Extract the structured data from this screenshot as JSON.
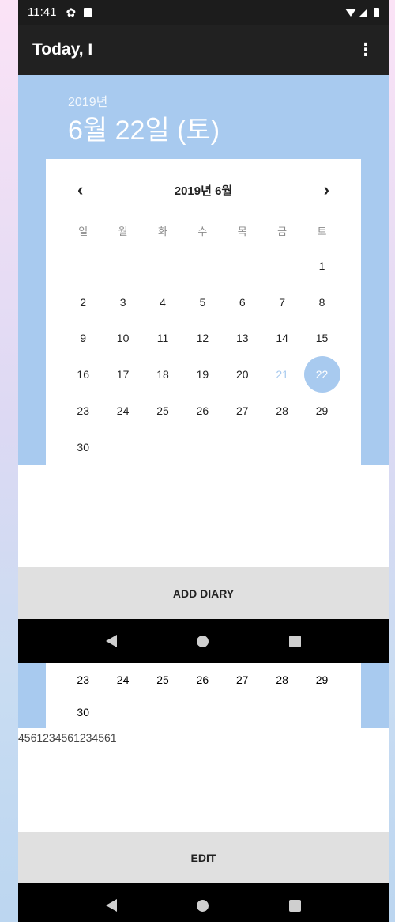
{
  "status_bar": {
    "time": "11:41",
    "icons": [
      "gear-icon",
      "sd-card-icon",
      "wifi-icon",
      "signal-icon",
      "battery-icon"
    ]
  },
  "appbar": {
    "title": "Today, I",
    "menu_icon": "more-vert-icon"
  },
  "header": {
    "year": "2019년",
    "date": "6월 22일 (토)"
  },
  "calendar": {
    "month_label": "2019년 6월",
    "weekdays": [
      "일",
      "월",
      "화",
      "수",
      "목",
      "금",
      "토"
    ],
    "days": [
      "1",
      "2",
      "3",
      "4",
      "5",
      "6",
      "7",
      "8",
      "9",
      "10",
      "11",
      "12",
      "13",
      "14",
      "15",
      "16",
      "17",
      "18",
      "19",
      "20",
      "21",
      "22",
      "23",
      "24",
      "25",
      "26",
      "27",
      "28",
      "29",
      "30"
    ],
    "today": "21",
    "selected": "22"
  },
  "second_screen": {
    "visible_days": [
      "23",
      "24",
      "25",
      "26",
      "27",
      "28",
      "29",
      "30"
    ],
    "note_text": "4561234561234561"
  },
  "buttons": {
    "add_diary": "ADD DIARY",
    "edit": "EDIT"
  },
  "colors": {
    "accent": "#a8caef",
    "appbar": "#212121",
    "button": "#e0e0e0"
  }
}
